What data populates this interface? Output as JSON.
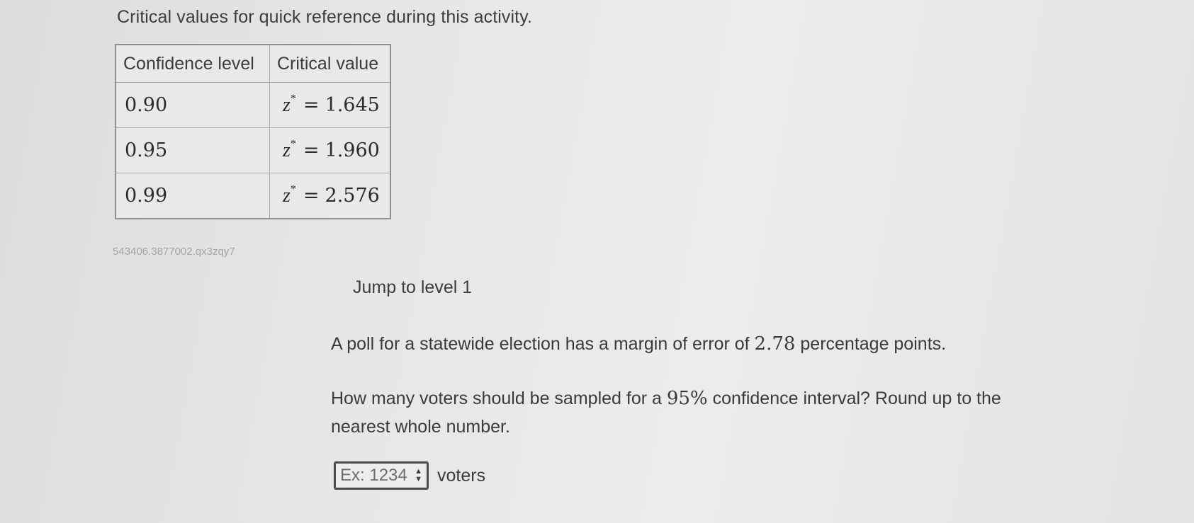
{
  "intro_text": "Critical values for quick reference during this activity.",
  "table": {
    "headers": [
      "Confidence level",
      "Critical value"
    ],
    "rows": [
      {
        "level": "0.90",
        "symbol": "z",
        "sup": "*",
        "eq": "=",
        "value": "1.645"
      },
      {
        "level": "0.95",
        "symbol": "z",
        "sup": "*",
        "eq": "=",
        "value": "1.960"
      },
      {
        "level": "0.99",
        "symbol": "z",
        "sup": "*",
        "eq": "=",
        "value": "2.576"
      }
    ]
  },
  "activity_code": "543406.3877002.qx3zqy7",
  "jump_label": "Jump to level 1",
  "question": {
    "line1_before": "A poll for a statewide election has a margin of error of ",
    "margin": "2.78",
    "line1_after": " percentage points.",
    "line2_before": "How many voters should be sampled for a ",
    "confidence": "95%",
    "line2_after": " confidence interval? Round up to the nearest whole number."
  },
  "answer": {
    "placeholder": "Ex: 1234",
    "value": "",
    "unit": "voters",
    "spinner_up": "▲",
    "spinner_down": "▼"
  }
}
